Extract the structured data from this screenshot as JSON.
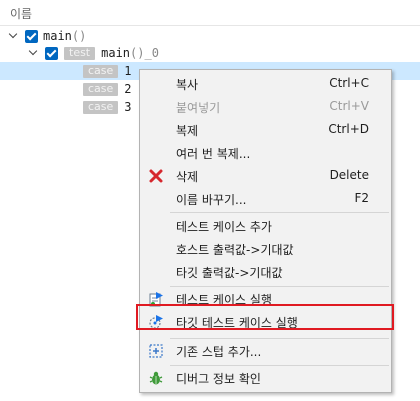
{
  "header": {
    "column_name": "이름"
  },
  "tree": {
    "root": {
      "name": "main",
      "parens": "()"
    },
    "child": {
      "badge": "test",
      "name": "main",
      "suffix": "()_0"
    },
    "cases": [
      {
        "badge": "case",
        "number": "1"
      },
      {
        "badge": "case",
        "number": "2"
      },
      {
        "badge": "case",
        "number": "3"
      }
    ]
  },
  "context_menu": {
    "items": [
      {
        "label": "복사",
        "shortcut": "Ctrl+C",
        "disabled": false
      },
      {
        "label": "붙여넣기",
        "shortcut": "Ctrl+V",
        "disabled": true
      },
      {
        "label": "복제",
        "shortcut": "Ctrl+D",
        "disabled": false
      },
      {
        "label": "여러 번 복제...",
        "shortcut": "",
        "disabled": false
      },
      {
        "label": "삭제",
        "shortcut": "Delete",
        "disabled": false,
        "icon": "delete-x-icon"
      },
      {
        "label": "이름 바꾸기...",
        "shortcut": "F2",
        "disabled": false
      },
      {
        "label": "테스트 케이스 추가",
        "shortcut": "",
        "disabled": false
      },
      {
        "label": "호스트 출력값->기대값",
        "shortcut": "",
        "disabled": false
      },
      {
        "label": "타깃 출력값->기대값",
        "shortcut": "",
        "disabled": false
      },
      {
        "label": "테스트 케이스 실행",
        "shortcut": "",
        "disabled": false,
        "icon": "run-test-icon"
      },
      {
        "label": "타깃 테스트 케이스 실행",
        "shortcut": "",
        "disabled": false,
        "icon": "run-target-test-icon"
      },
      {
        "label": "기존 스텁 추가...",
        "shortcut": "",
        "disabled": false,
        "icon": "add-stub-icon"
      },
      {
        "label": "디버그 정보 확인",
        "shortcut": "",
        "disabled": false,
        "icon": "bug-icon"
      }
    ]
  },
  "colors": {
    "selection": "#cce8ff",
    "checkbox": "#0067c0",
    "highlight_border": "#e01a22"
  }
}
